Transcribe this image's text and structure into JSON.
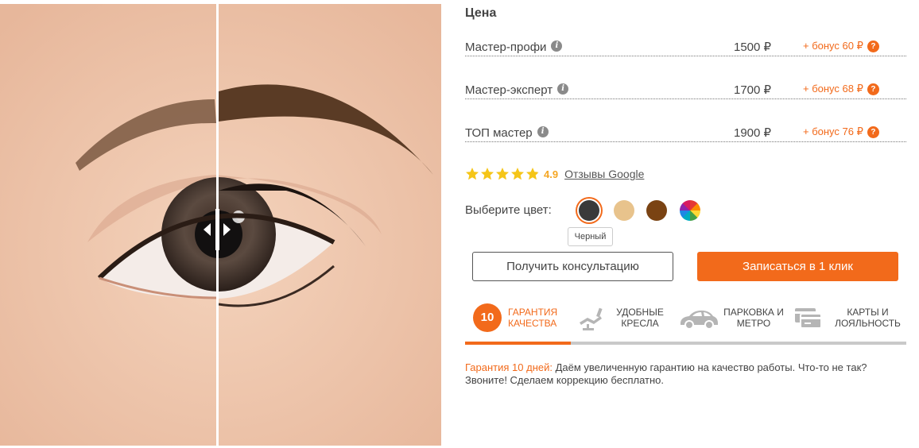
{
  "price_title": "Цена",
  "prices": [
    {
      "name": "Мастер-профи",
      "price": "1500 ₽",
      "bonus": "+ бонус 60 ₽"
    },
    {
      "name": "Мастер-эксперт",
      "price": "1700 ₽",
      "bonus": "+ бонус 68 ₽"
    },
    {
      "name": "ТОП мастер",
      "price": "1900 ₽",
      "bonus": "+ бонус 76 ₽"
    }
  ],
  "rating": {
    "score": "4.9",
    "stars": 4.9,
    "reviews_link": "Отзывы Google"
  },
  "color": {
    "label": "Выберите цвет:",
    "tooltip": "Черный",
    "options": [
      {
        "name": "black",
        "hex": "#3a3a3a"
      },
      {
        "name": "light-brown",
        "hex": "#e8c38c"
      },
      {
        "name": "brown",
        "hex": "#7a4313"
      },
      {
        "name": "multicolor",
        "hex": "multi"
      }
    ]
  },
  "buttons": {
    "consult": "Получить консультацию",
    "book": "Записаться в 1 клик"
  },
  "features": [
    {
      "badge": "10",
      "line1": "ГАРАНТИЯ",
      "line2": "КАЧЕСТВА"
    },
    {
      "line1": "УДОБНЫЕ",
      "line2": "КРЕСЛА"
    },
    {
      "line1": "ПАРКОВКА И",
      "line2": "МЕТРО"
    },
    {
      "line1": "КАРТЫ И",
      "line2": "ЛОЯЛЬНОСТЬ"
    }
  ],
  "description": {
    "highlight": "Гарантия 10 дней:",
    "text": " Даём увеличенную гарантию на качество работы. Что-то не так? Звоните! Сделаем коррекцию бесплатно."
  },
  "colors": {
    "accent": "#f26a1b",
    "star": "#f5c518"
  }
}
